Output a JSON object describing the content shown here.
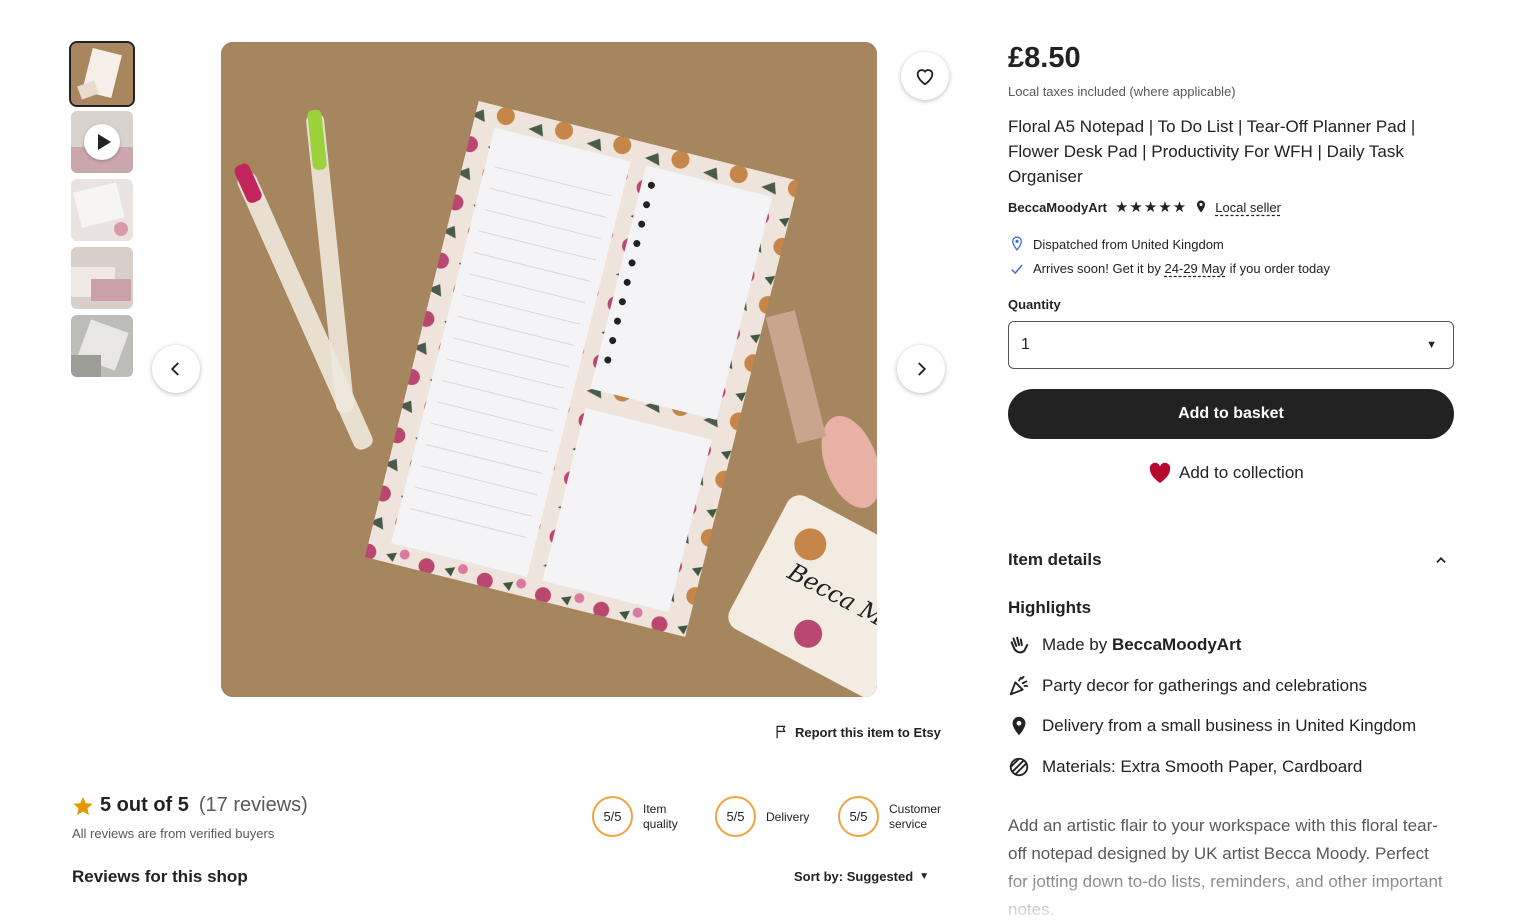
{
  "gallery": {
    "thumbnails": [
      "thumb-1",
      "thumb-2-video",
      "thumb-3",
      "thumb-4",
      "thumb-5"
    ],
    "card_text": "Becca Moody Art"
  },
  "report_label": "Report this item to Etsy",
  "reviews": {
    "score_text": "5 out of 5",
    "count_text": "(17 reviews)",
    "verified_note": "All reviews are from verified buyers",
    "shop_reviews_title": "Reviews for this shop",
    "metrics": [
      {
        "score": "5/5",
        "label_line1": "Item",
        "label_line2": "quality"
      },
      {
        "score": "5/5",
        "label_line1": "Delivery",
        "label_line2": ""
      },
      {
        "score": "5/5",
        "label_line1": "Customer",
        "label_line2": "service"
      }
    ],
    "sort_label": "Sort by: Suggested"
  },
  "listing": {
    "price": "£8.50",
    "tax_note": "Local taxes included (where applicable)",
    "title": "Floral A5 Notepad | To Do List | Tear-Off Planner Pad | Flower Desk Pad | Productivity For WFH | Daily Task Organiser",
    "seller": "BeccaMoodyArt",
    "stars": "★★★★★",
    "local_seller": "Local seller",
    "dispatch": "Dispatched from United Kingdom",
    "arrival_prefix": "Arrives soon! Get it by",
    "arrival_dates": "24-29 May",
    "arrival_suffix": "if you order today",
    "quantity_label": "Quantity",
    "quantity_value": "1",
    "add_to_basket": "Add to basket",
    "add_to_collection": "Add to collection",
    "item_details": "Item details",
    "highlights_title": "Highlights",
    "made_by_prefix": "Made by",
    "made_by_shop": "BeccaMoodyArt",
    "highlight_party": "Party decor for gatherings and celebrations",
    "highlight_delivery": "Delivery from a small business in United Kingdom",
    "highlight_materials": "Materials: Extra Smooth Paper, Cardboard",
    "description": "Add an artistic flair to your workspace with this floral tear-off notepad designed by UK artist Becca Moody. Perfect for jotting down to-do lists, reminders, and other important notes."
  },
  "colors": {
    "accent": "#222222",
    "heart": "#b7092b",
    "rating_ring": "#f1a33c",
    "star": "#e59700",
    "link_blue": "#3e6ad6"
  }
}
